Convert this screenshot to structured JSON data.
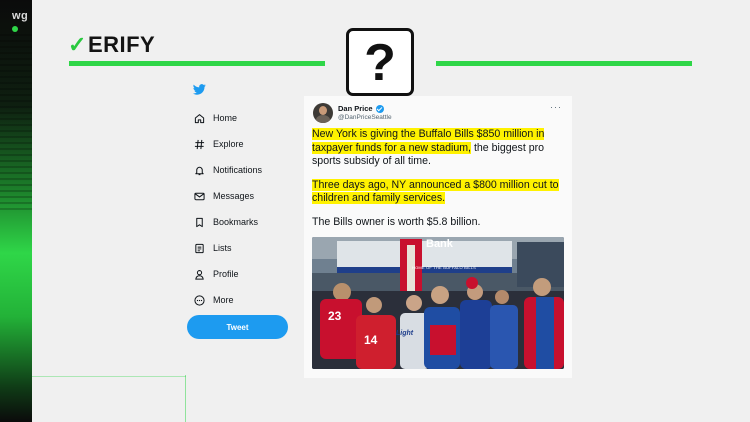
{
  "station": {
    "label": "wg"
  },
  "brand": {
    "logo_check": "✓",
    "logo_text": "ERIFY",
    "accent": "#2fd648"
  },
  "question_mark": "?",
  "twitter_nav": {
    "items": [
      {
        "label": "Home",
        "icon": "home-icon"
      },
      {
        "label": "Explore",
        "icon": "hashtag-icon"
      },
      {
        "label": "Notifications",
        "icon": "bell-icon"
      },
      {
        "label": "Messages",
        "icon": "envelope-icon"
      },
      {
        "label": "Bookmarks",
        "icon": "bookmark-icon"
      },
      {
        "label": "Lists",
        "icon": "list-icon"
      },
      {
        "label": "Profile",
        "icon": "person-icon"
      },
      {
        "label": "More",
        "icon": "more-circle-icon"
      }
    ],
    "tweet_button": "Tweet"
  },
  "tweet": {
    "author": "Dan Price",
    "handle": "@DanPriceSeattle",
    "p1_highlight": "New York is giving the Buffalo Bills $850 million in taxpayer funds for a new stadium,",
    "p1_rest": " the biggest pro sports subsidy of all time.",
    "p2_highlight": "Three days ago, NY announced a $800 million cut to children and family services.",
    "p3": "The Bills owner is worth $5.8 billion.",
    "photo": {
      "sign_bank": "Bank",
      "sign_small": "HOME OF THE BUFFALO BILLS",
      "number_left": "23",
      "number_mid": "14",
      "light": "Light"
    }
  }
}
